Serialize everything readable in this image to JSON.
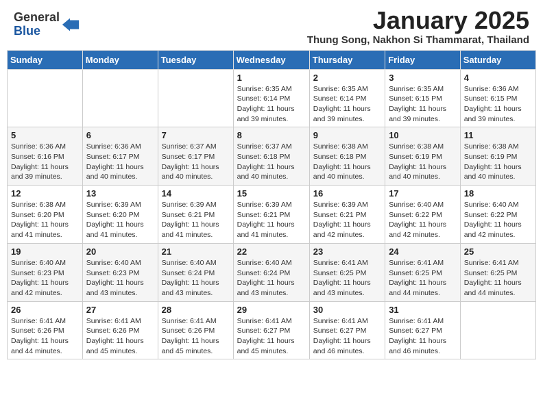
{
  "header": {
    "logo_general": "General",
    "logo_blue": "Blue",
    "month_title": "January 2025",
    "location": "Thung Song, Nakhon Si Thammarat, Thailand"
  },
  "days_of_week": [
    "Sunday",
    "Monday",
    "Tuesday",
    "Wednesday",
    "Thursday",
    "Friday",
    "Saturday"
  ],
  "weeks": [
    [
      {
        "day": "",
        "info": ""
      },
      {
        "day": "",
        "info": ""
      },
      {
        "day": "",
        "info": ""
      },
      {
        "day": "1",
        "info": "Sunrise: 6:35 AM\nSunset: 6:14 PM\nDaylight: 11 hours and 39 minutes."
      },
      {
        "day": "2",
        "info": "Sunrise: 6:35 AM\nSunset: 6:14 PM\nDaylight: 11 hours and 39 minutes."
      },
      {
        "day": "3",
        "info": "Sunrise: 6:35 AM\nSunset: 6:15 PM\nDaylight: 11 hours and 39 minutes."
      },
      {
        "day": "4",
        "info": "Sunrise: 6:36 AM\nSunset: 6:15 PM\nDaylight: 11 hours and 39 minutes."
      }
    ],
    [
      {
        "day": "5",
        "info": "Sunrise: 6:36 AM\nSunset: 6:16 PM\nDaylight: 11 hours and 39 minutes."
      },
      {
        "day": "6",
        "info": "Sunrise: 6:36 AM\nSunset: 6:17 PM\nDaylight: 11 hours and 40 minutes."
      },
      {
        "day": "7",
        "info": "Sunrise: 6:37 AM\nSunset: 6:17 PM\nDaylight: 11 hours and 40 minutes."
      },
      {
        "day": "8",
        "info": "Sunrise: 6:37 AM\nSunset: 6:18 PM\nDaylight: 11 hours and 40 minutes."
      },
      {
        "day": "9",
        "info": "Sunrise: 6:38 AM\nSunset: 6:18 PM\nDaylight: 11 hours and 40 minutes."
      },
      {
        "day": "10",
        "info": "Sunrise: 6:38 AM\nSunset: 6:19 PM\nDaylight: 11 hours and 40 minutes."
      },
      {
        "day": "11",
        "info": "Sunrise: 6:38 AM\nSunset: 6:19 PM\nDaylight: 11 hours and 40 minutes."
      }
    ],
    [
      {
        "day": "12",
        "info": "Sunrise: 6:38 AM\nSunset: 6:20 PM\nDaylight: 11 hours and 41 minutes."
      },
      {
        "day": "13",
        "info": "Sunrise: 6:39 AM\nSunset: 6:20 PM\nDaylight: 11 hours and 41 minutes."
      },
      {
        "day": "14",
        "info": "Sunrise: 6:39 AM\nSunset: 6:21 PM\nDaylight: 11 hours and 41 minutes."
      },
      {
        "day": "15",
        "info": "Sunrise: 6:39 AM\nSunset: 6:21 PM\nDaylight: 11 hours and 41 minutes."
      },
      {
        "day": "16",
        "info": "Sunrise: 6:39 AM\nSunset: 6:21 PM\nDaylight: 11 hours and 42 minutes."
      },
      {
        "day": "17",
        "info": "Sunrise: 6:40 AM\nSunset: 6:22 PM\nDaylight: 11 hours and 42 minutes."
      },
      {
        "day": "18",
        "info": "Sunrise: 6:40 AM\nSunset: 6:22 PM\nDaylight: 11 hours and 42 minutes."
      }
    ],
    [
      {
        "day": "19",
        "info": "Sunrise: 6:40 AM\nSunset: 6:23 PM\nDaylight: 11 hours and 42 minutes."
      },
      {
        "day": "20",
        "info": "Sunrise: 6:40 AM\nSunset: 6:23 PM\nDaylight: 11 hours and 43 minutes."
      },
      {
        "day": "21",
        "info": "Sunrise: 6:40 AM\nSunset: 6:24 PM\nDaylight: 11 hours and 43 minutes."
      },
      {
        "day": "22",
        "info": "Sunrise: 6:40 AM\nSunset: 6:24 PM\nDaylight: 11 hours and 43 minutes."
      },
      {
        "day": "23",
        "info": "Sunrise: 6:41 AM\nSunset: 6:25 PM\nDaylight: 11 hours and 43 minutes."
      },
      {
        "day": "24",
        "info": "Sunrise: 6:41 AM\nSunset: 6:25 PM\nDaylight: 11 hours and 44 minutes."
      },
      {
        "day": "25",
        "info": "Sunrise: 6:41 AM\nSunset: 6:25 PM\nDaylight: 11 hours and 44 minutes."
      }
    ],
    [
      {
        "day": "26",
        "info": "Sunrise: 6:41 AM\nSunset: 6:26 PM\nDaylight: 11 hours and 44 minutes."
      },
      {
        "day": "27",
        "info": "Sunrise: 6:41 AM\nSunset: 6:26 PM\nDaylight: 11 hours and 45 minutes."
      },
      {
        "day": "28",
        "info": "Sunrise: 6:41 AM\nSunset: 6:26 PM\nDaylight: 11 hours and 45 minutes."
      },
      {
        "day": "29",
        "info": "Sunrise: 6:41 AM\nSunset: 6:27 PM\nDaylight: 11 hours and 45 minutes."
      },
      {
        "day": "30",
        "info": "Sunrise: 6:41 AM\nSunset: 6:27 PM\nDaylight: 11 hours and 46 minutes."
      },
      {
        "day": "31",
        "info": "Sunrise: 6:41 AM\nSunset: 6:27 PM\nDaylight: 11 hours and 46 minutes."
      },
      {
        "day": "",
        "info": ""
      }
    ]
  ]
}
